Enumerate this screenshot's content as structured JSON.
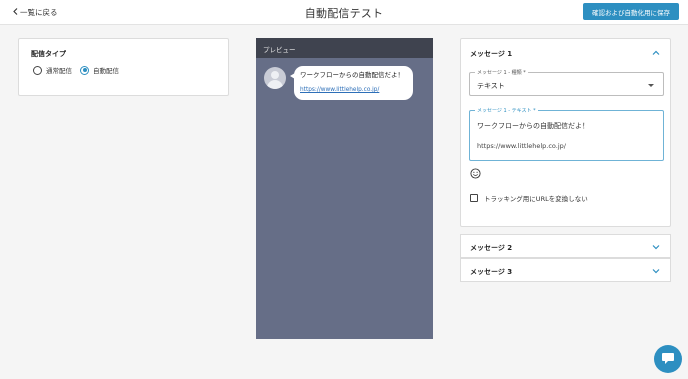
{
  "header": {
    "back_label": "一覧に戻る",
    "title": "自動配信テスト",
    "save_label": "確認および自動化用に保存"
  },
  "delivery": {
    "label": "配信タイプ",
    "options": [
      {
        "label": "通常配信",
        "selected": false
      },
      {
        "label": "自動配信",
        "selected": true
      }
    ]
  },
  "preview": {
    "label": "プレビュー",
    "message_text": "ワークフローからの自動配信だよ！",
    "message_link": "https://www.littlehelp.co.jp/"
  },
  "messages": [
    {
      "title": "メッセージ 1",
      "expanded": true,
      "type_label": "メッセージ 1 - 種類 *",
      "type_value": "テキスト",
      "text_label": "メッセージ 1 - テキスト *",
      "text_line1": "ワークフローからの自動配信だよ！",
      "text_line2": "https://www.littlehelp.co.jp/",
      "tracking_label": "トラッキング用にURLを変換しない",
      "tracking_checked": false
    },
    {
      "title": "メッセージ 2",
      "expanded": false
    },
    {
      "title": "メッセージ 3",
      "expanded": false
    }
  ],
  "colors": {
    "accent": "#2d8fc1",
    "preview_bg": "#666e87",
    "preview_header": "#3f434f"
  },
  "icons": {
    "back": "chevron-left-icon",
    "expand": "chevron-up-icon",
    "collapse": "chevron-down-icon",
    "emoji": "smiley-icon",
    "chat": "chat-bubble-icon"
  }
}
